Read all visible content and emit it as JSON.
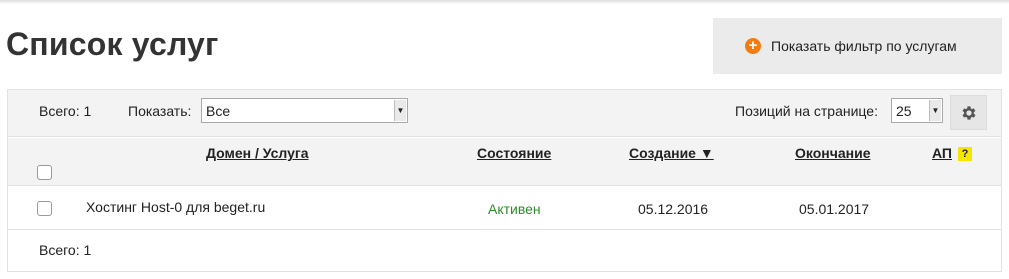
{
  "page": {
    "title": "Список услуг"
  },
  "filter": {
    "label": "Показать фильтр по услугам",
    "icon": "plus-circle-icon",
    "icon_color": "#f07c12"
  },
  "toolbar": {
    "total": "Всего: 1",
    "show_label": "Показать:",
    "show_value": "Все",
    "per_page_label": "Позиций на странице:",
    "per_page_value": "25",
    "settings_icon": "gear-icon"
  },
  "table": {
    "columns": {
      "domain": "Домен / Услуга",
      "status": "Состояние",
      "created": "Создание ▼",
      "end": "Окончание",
      "ap": "АП",
      "ap_help": "?"
    },
    "rows": [
      {
        "service": "Хостинг Host-0 для beget.ru",
        "status": "Активен",
        "created": "05.12.2016",
        "end": "05.01.2017"
      }
    ]
  },
  "footer": {
    "total": "Всего: 1"
  },
  "colors": {
    "status_active": "#2e8b2e",
    "help_badge": "#f5e600"
  }
}
